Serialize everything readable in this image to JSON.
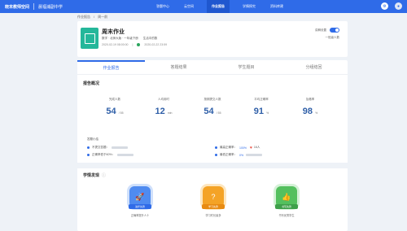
{
  "topbar": {
    "brand": "晓末教师空间",
    "school": "晨福浦副中学",
    "nav": [
      "答题中心",
      "云空间",
      "作业报告",
      "学情探究",
      "资料库建"
    ],
    "active_nav": "作业报告"
  },
  "breadcrumb": [
    "作业报告",
    "/",
    "周一前"
  ],
  "homework": {
    "title": "周末作业",
    "subject_line": "数学 · 北师大版 · 一年级下册",
    "chapter": "生活中的数",
    "meta_date": "2020-02-19 08:00:00",
    "meta_sep": "|",
    "meta_end": "2020-02-22 23:59",
    "switch_label": "讲解设置",
    "side_note": "一班级人数"
  },
  "tabs": [
    "作业报告",
    "答题结果",
    "学生题目",
    "分组结回"
  ],
  "report": {
    "title": "报告概况",
    "stats": [
      {
        "label": "完成人数",
        "value": "54",
        "unit": "/ 55"
      },
      {
        "label": "人均用时",
        "value": "12",
        "unit": "min"
      },
      {
        "label": "按期提交人数",
        "value": "54",
        "unit": "/ 55"
      },
      {
        "label": "平均正确率",
        "value": "91",
        "unit": "%"
      },
      {
        "label": "及格率",
        "value": "98",
        "unit": "%"
      }
    ],
    "details_head": "答题小结",
    "details": [
      {
        "left": "不提交答题：",
        "right_label": "最高正确率：",
        "right_value": "100%",
        "right_extra": "16人"
      },
      {
        "left": "正确率低于60%：",
        "right_label": "最低正确率：",
        "right_value": "0%"
      }
    ]
  },
  "learning": {
    "title": "学情发现",
    "badges": [
      {
        "icon": "rocket-icon",
        "ribbon": "进步先锋",
        "desc": "正确率提升人十",
        "color": "blue"
      },
      {
        "icon": "question-icon",
        "ribbon": "学习先锋",
        "desc": "学习时长最多",
        "color": "orange"
      },
      {
        "icon": "thumb-icon",
        "ribbon": "书写先锋",
        "desc": "书写优秀学生",
        "color": "green"
      }
    ]
  }
}
